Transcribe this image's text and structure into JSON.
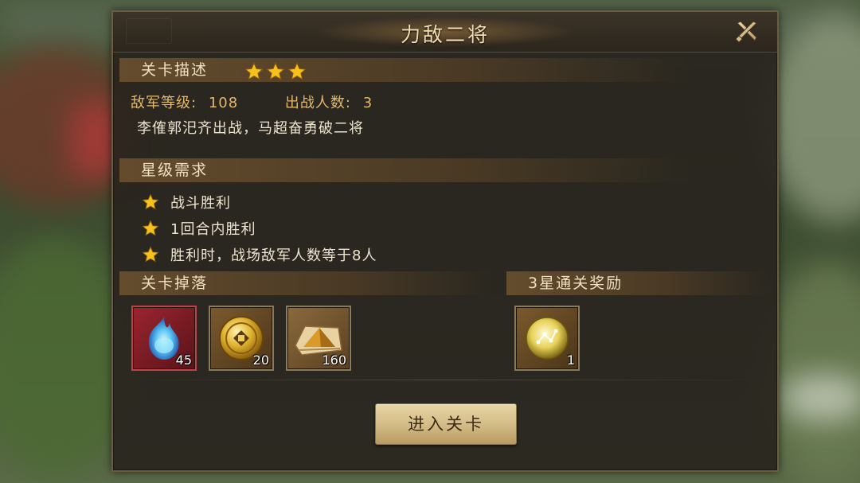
{
  "dialog": {
    "title": "力敌二将",
    "close_icon": "close-icon"
  },
  "description": {
    "header": "关卡描述",
    "star_rating": 3,
    "enemy_level_label": "敌军等级:",
    "enemy_level_value": "108",
    "battle_count_label": "出战人数:",
    "battle_count_value": "3",
    "text": "李傕郭汜齐出战，马超奋勇破二将"
  },
  "requirements": {
    "header": "星级需求",
    "items": [
      {
        "label": "战斗胜利"
      },
      {
        "label": "1回合内胜利"
      },
      {
        "label": "胜利时，战场敌军人数等于8人"
      }
    ]
  },
  "drops": {
    "header": "关卡掉落",
    "items": [
      {
        "icon": "blue-flame-gem-icon",
        "count": "45"
      },
      {
        "icon": "gold-coin-icon",
        "count": "20"
      },
      {
        "icon": "pyramid-map-icon",
        "count": "160"
      }
    ]
  },
  "rewards": {
    "header": "3星通关奖励",
    "items": [
      {
        "icon": "golden-orb-icon",
        "count": "1"
      }
    ]
  },
  "enter_button": "进入关卡",
  "colors": {
    "panel_bg": "#28241e",
    "header_text": "#f1e1c0",
    "info_text": "#e6b86a",
    "star": "#f5c21b",
    "button_bg": "#d2ba84"
  }
}
